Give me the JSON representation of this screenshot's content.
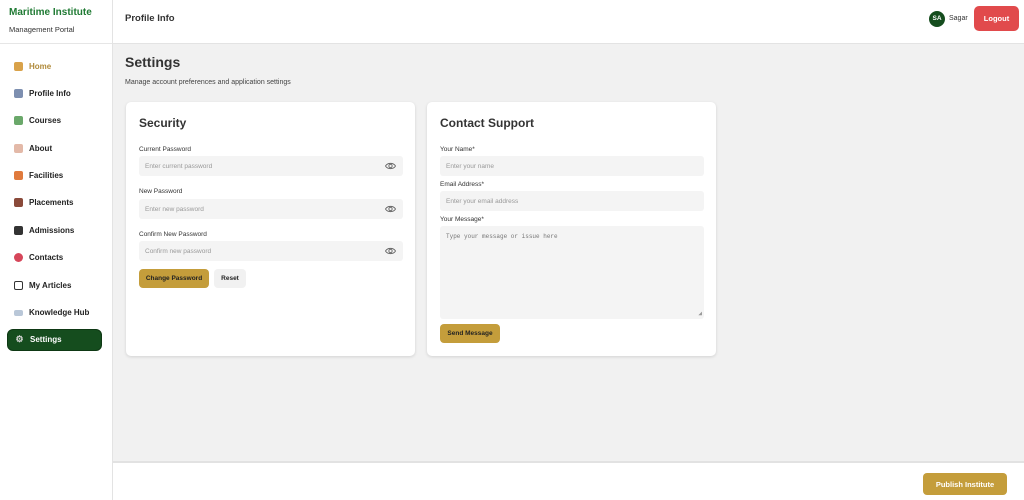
{
  "brand": {
    "title": "Maritime Institute",
    "subtitle": "Management Portal"
  },
  "sidebar": {
    "items": [
      {
        "label": "Home",
        "icon": "home-icon"
      },
      {
        "label": "Profile Info",
        "icon": "profile-icon"
      },
      {
        "label": "Courses",
        "icon": "books-icon"
      },
      {
        "label": "About",
        "icon": "about-icon"
      },
      {
        "label": "Facilities",
        "icon": "facilities-icon"
      },
      {
        "label": "Placements",
        "icon": "briefcase-icon"
      },
      {
        "label": "Admissions",
        "icon": "graduation-cap-icon"
      },
      {
        "label": "Contacts",
        "icon": "phone-icon"
      },
      {
        "label": "My Articles",
        "icon": "document-icon"
      },
      {
        "label": "Knowledge Hub",
        "icon": "book-open-icon"
      },
      {
        "label": "Settings",
        "icon": "gear-icon"
      }
    ]
  },
  "header": {
    "title": "Profile Info",
    "avatar_initials": "SA",
    "username": "Sagar",
    "logout_label": "Logout"
  },
  "page": {
    "title": "Settings",
    "subtitle": "Manage account preferences and application settings"
  },
  "security": {
    "title": "Security",
    "current_label": "Current Password",
    "current_placeholder": "Enter current password",
    "new_label": "New Password",
    "new_placeholder": "Enter new password",
    "confirm_label": "Confirm New Password",
    "confirm_placeholder": "Confirm new password",
    "change_button": "Change Password",
    "reset_button": "Reset"
  },
  "support": {
    "title": "Contact Support",
    "name_label": "Your Name*",
    "name_placeholder": "Enter your name",
    "email_label": "Email Address*",
    "email_placeholder": "Enter your email address",
    "message_label": "Your Message*",
    "message_placeholder": "Type your message or issue here",
    "send_button": "Send Message"
  },
  "footer": {
    "publish_label": "Publish Institute"
  },
  "colors": {
    "brand_green": "#1f7a33",
    "active_green": "#154d1e",
    "gold": "#c49d3b",
    "logout_red": "#e14a4c"
  }
}
